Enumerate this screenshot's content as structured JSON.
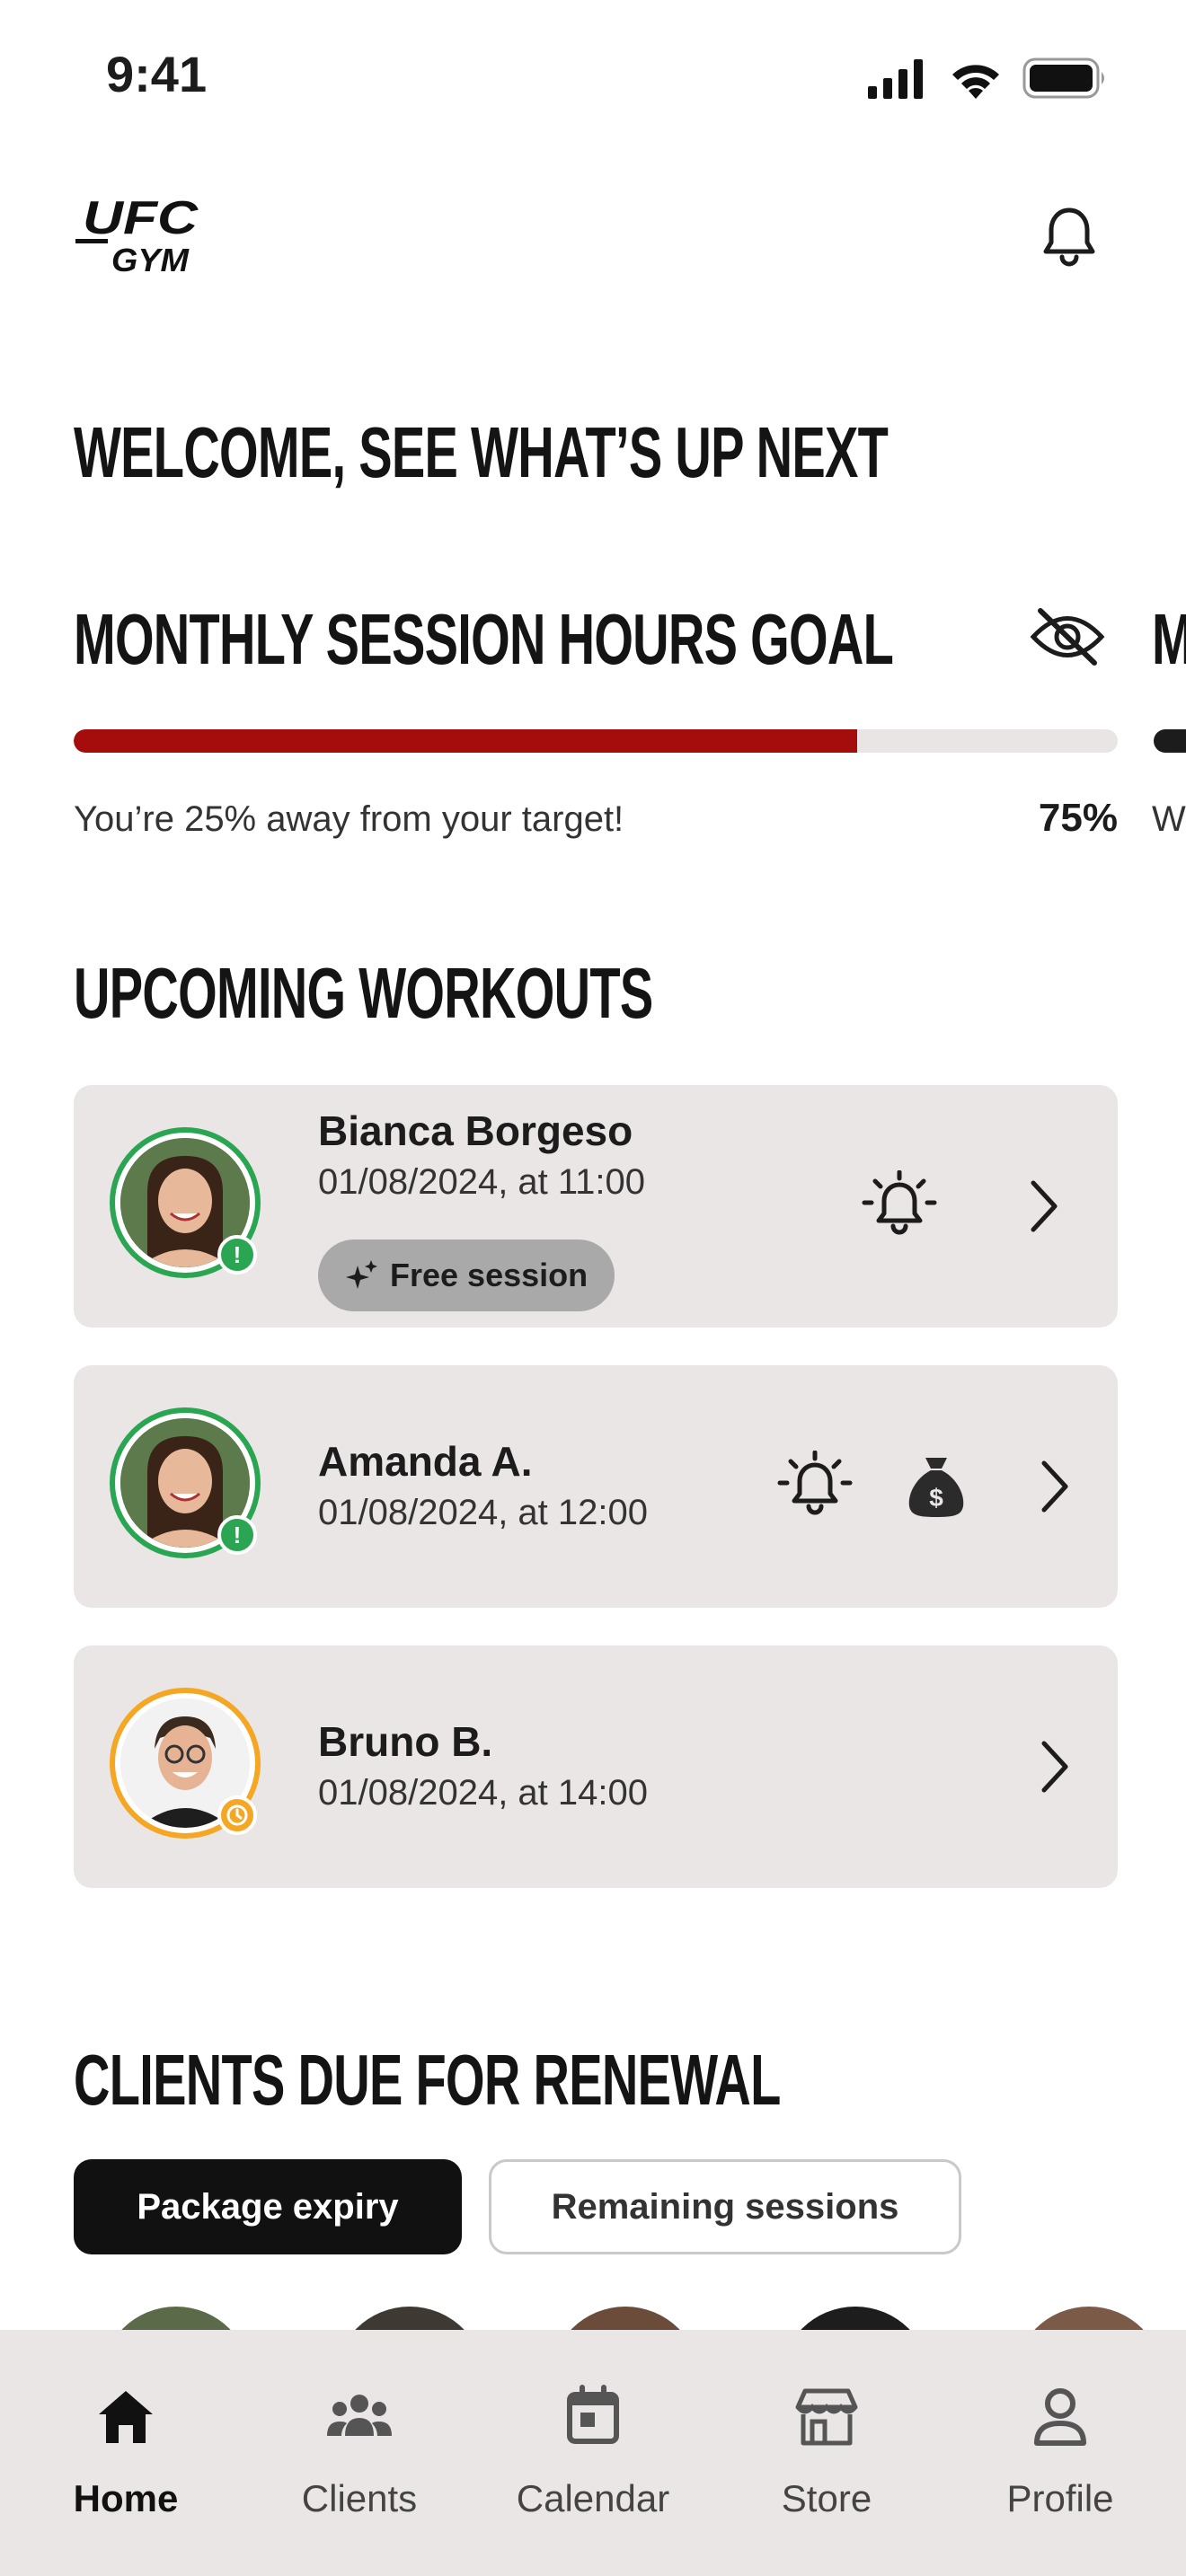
{
  "status_bar": {
    "time": "9:41"
  },
  "header": {
    "logo_text_top": "UFC",
    "logo_text_bottom": "GYM"
  },
  "welcome_title": "WELCOME, SEE WHAT’S UP NEXT",
  "goal": {
    "title": "MONTHLY SESSION HOURS GOAL",
    "progress_fraction": 0.75,
    "message": "You’re 25% away from your target!",
    "percent_label": "75%",
    "peek_title": "M",
    "peek_message": "W"
  },
  "workouts": {
    "title": "UPCOMING WORKOUTS",
    "items": [
      {
        "name": "Bianca Borgeso",
        "time": "01/08/2024, at 11:00",
        "chip": "Free session",
        "status": "confirmed"
      },
      {
        "name": "Amanda A.",
        "time": "01/08/2024, at 12:00",
        "status": "confirmed"
      },
      {
        "name": "Bruno B.",
        "time": "01/08/2024, at 14:00",
        "status": "pending"
      }
    ]
  },
  "renewal": {
    "title": "CLIENTS DUE FOR RENEWAL",
    "filters": [
      "Package expiry",
      "Remaining sessions"
    ]
  },
  "nav": {
    "items": [
      {
        "label": "Home",
        "icon": "home-icon"
      },
      {
        "label": "Clients",
        "icon": "clients-icon"
      },
      {
        "label": "Calendar",
        "icon": "calendar-icon"
      },
      {
        "label": "Store",
        "icon": "store-icon"
      },
      {
        "label": "Profile",
        "icon": "profile-icon"
      }
    ]
  },
  "colors": {
    "accent_red": "#a50d0d",
    "success_green": "#2aa552",
    "warning_orange": "#f5a623",
    "card_bg": "#eae6e5"
  }
}
